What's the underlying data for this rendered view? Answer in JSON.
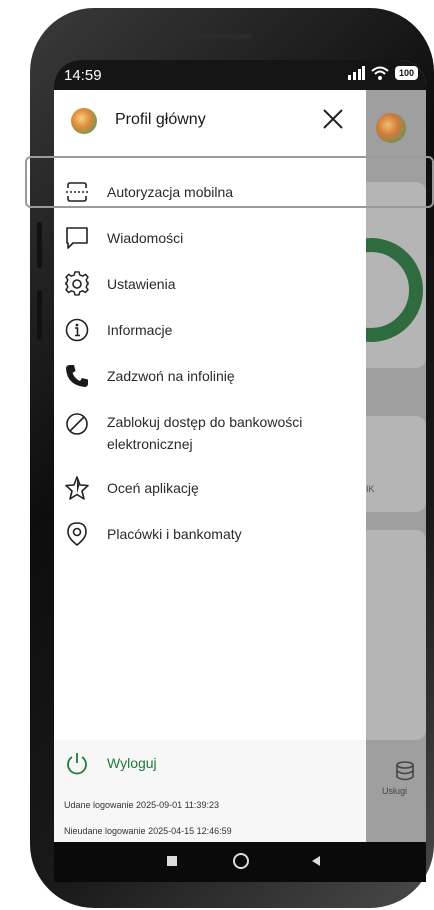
{
  "status_bar": {
    "time": "14:59",
    "battery": "100",
    "icons": [
      "signal-icon",
      "wifi-icon",
      "battery-icon"
    ]
  },
  "drawer": {
    "profile_title": "Profil główny",
    "close_icon": "close-icon",
    "items": [
      {
        "label": "Autoryzacja mobilna",
        "icon": "mobile-authorization-icon"
      },
      {
        "label": "Wiadomości",
        "icon": "message-icon"
      },
      {
        "label": "Ustawienia",
        "icon": "settings-icon"
      },
      {
        "label": "Informacje",
        "icon": "info-icon"
      },
      {
        "label": "Zadzwoń na infolinię",
        "icon": "phone-icon"
      },
      {
        "label": "Zablokuj dostęp do bankowości",
        "label_line2": "elektronicznej",
        "icon": "block-icon"
      },
      {
        "label": "Oceń aplikację",
        "icon": "star-icon"
      },
      {
        "label": "Placówki i bankomaty",
        "icon": "location-icon"
      }
    ],
    "logout_label": "Wyloguj",
    "last_login_success": "Udane logowanie 2025-09-01 11:39:23",
    "last_login_failed": "Nieudane logowanie 2025-04-15 12:46:59"
  },
  "background_app": {
    "services_label": "Usługi",
    "partial_text": "IK"
  },
  "colors": {
    "accent_green": "#1f7a3a",
    "ring_green": "#2f6b3f",
    "statusbar": "#151515"
  }
}
